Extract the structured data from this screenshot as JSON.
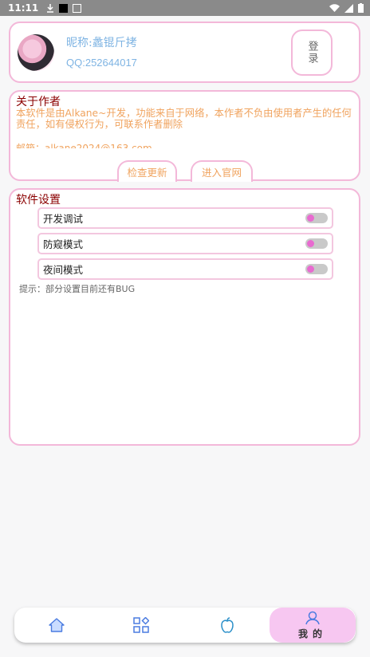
{
  "status_bar": {
    "time": "11:11",
    "icons": [
      "download-icon",
      "black-square-icon",
      "app-notification-icon"
    ],
    "right_icons": [
      "wifi-icon",
      "signal-icon",
      "battery-icon"
    ]
  },
  "profile": {
    "nickname": "昵称:蠡锟斤拷",
    "qq": "QQ:252644017",
    "login_label": "登录"
  },
  "about": {
    "title": "关于作者",
    "text": "本软件是由Alkane~开发，功能来自于网络，本作者不负由使用者产生的任何责任，如有侵权行为，可联系作者删除",
    "email": "邮箱：alkane2024@163.com",
    "check_update_label": "检查更新",
    "official_site_label": "进入官网"
  },
  "settings": {
    "title": "软件设置",
    "items": [
      {
        "label": "开发调试",
        "enabled": false
      },
      {
        "label": "防窥模式",
        "enabled": false
      },
      {
        "label": "夜间模式",
        "enabled": false
      }
    ],
    "hint": "提示：部分设置目前还有BUG"
  },
  "bottom_nav": {
    "items": [
      {
        "icon": "home-icon",
        "label": ""
      },
      {
        "icon": "apps-grid-icon",
        "label": ""
      },
      {
        "icon": "apple-icon",
        "label": ""
      },
      {
        "icon": "user-icon",
        "label": "我的",
        "active": true
      }
    ]
  },
  "colors": {
    "accent_pink": "#f3b8d9",
    "title_red": "#8b0000",
    "text_orange": "#f0a35e",
    "profile_blue": "#7fb4e3",
    "toggle_knob": "#e86bd0"
  }
}
